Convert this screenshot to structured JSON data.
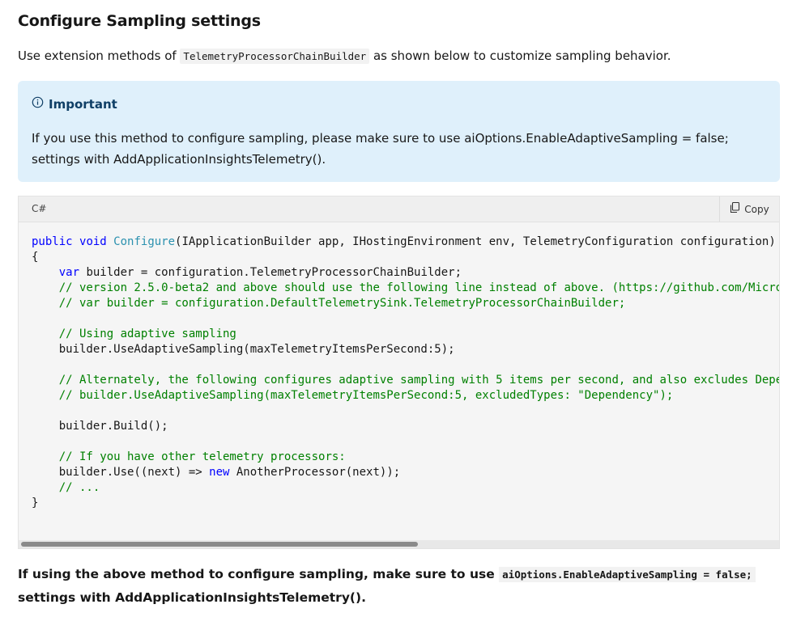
{
  "heading": "Configure Sampling settings",
  "intro": {
    "before": "Use extension methods of ",
    "code": "TelemetryProcessorChainBuilder",
    "after": " as shown below to customize sampling behavior."
  },
  "alert": {
    "icon": "info-icon",
    "title": "Important",
    "body": "If you use this method to configure sampling, please make sure to use aiOptions.EnableAdaptiveSampling = false; settings with AddApplicationInsightsTelemetry()."
  },
  "code_block": {
    "language": "C#",
    "copy_label": "Copy",
    "copy_icon": "copy-icon",
    "lines": [
      [
        [
          "kw",
          "public"
        ],
        [
          "t",
          " "
        ],
        [
          "kw",
          "void"
        ],
        [
          "t",
          " "
        ],
        [
          "fn",
          "Configure"
        ],
        [
          "t",
          "(IApplicationBuilder app, IHostingEnvironment env, TelemetryConfiguration configuration)"
        ]
      ],
      [
        [
          "t",
          "{"
        ]
      ],
      [
        [
          "t",
          "    "
        ],
        [
          "kw",
          "var"
        ],
        [
          "t",
          " builder = configuration.TelemetryProcessorChainBuilder;"
        ]
      ],
      [
        [
          "t",
          "    "
        ],
        [
          "cm",
          "// version 2.5.0-beta2 and above should use the following line instead of above. (https://github.com/Micro"
        ]
      ],
      [
        [
          "t",
          "    "
        ],
        [
          "cm",
          "// var builder = configuration.DefaultTelemetrySink.TelemetryProcessorChainBuilder;"
        ]
      ],
      [
        [
          "t",
          ""
        ]
      ],
      [
        [
          "t",
          "    "
        ],
        [
          "cm",
          "// Using adaptive sampling"
        ]
      ],
      [
        [
          "t",
          "    builder.UseAdaptiveSampling(maxTelemetryItemsPerSecond:5);"
        ]
      ],
      [
        [
          "t",
          ""
        ]
      ],
      [
        [
          "t",
          "    "
        ],
        [
          "cm",
          "// Alternately, the following configures adaptive sampling with 5 items per second, and also excludes Depe"
        ]
      ],
      [
        [
          "t",
          "    "
        ],
        [
          "cm",
          "// builder.UseAdaptiveSampling(maxTelemetryItemsPerSecond:5, excludedTypes: \"Dependency\");"
        ]
      ],
      [
        [
          "t",
          ""
        ]
      ],
      [
        [
          "t",
          "    builder.Build();"
        ]
      ],
      [
        [
          "t",
          ""
        ]
      ],
      [
        [
          "t",
          "    "
        ],
        [
          "cm",
          "// If you have other telemetry processors:"
        ]
      ],
      [
        [
          "t",
          "    builder.Use((next) => "
        ],
        [
          "kw",
          "new"
        ],
        [
          "t",
          " AnotherProcessor(next));"
        ]
      ],
      [
        [
          "t",
          "    "
        ],
        [
          "cm",
          "// ..."
        ]
      ],
      [
        [
          "t",
          "}"
        ]
      ]
    ]
  },
  "closing": {
    "before": "If using the above method to configure sampling, make sure to use ",
    "code": "aiOptions.EnableAdaptiveSampling = false;",
    "after": " settings with AddApplicationInsightsTelemetry()."
  }
}
